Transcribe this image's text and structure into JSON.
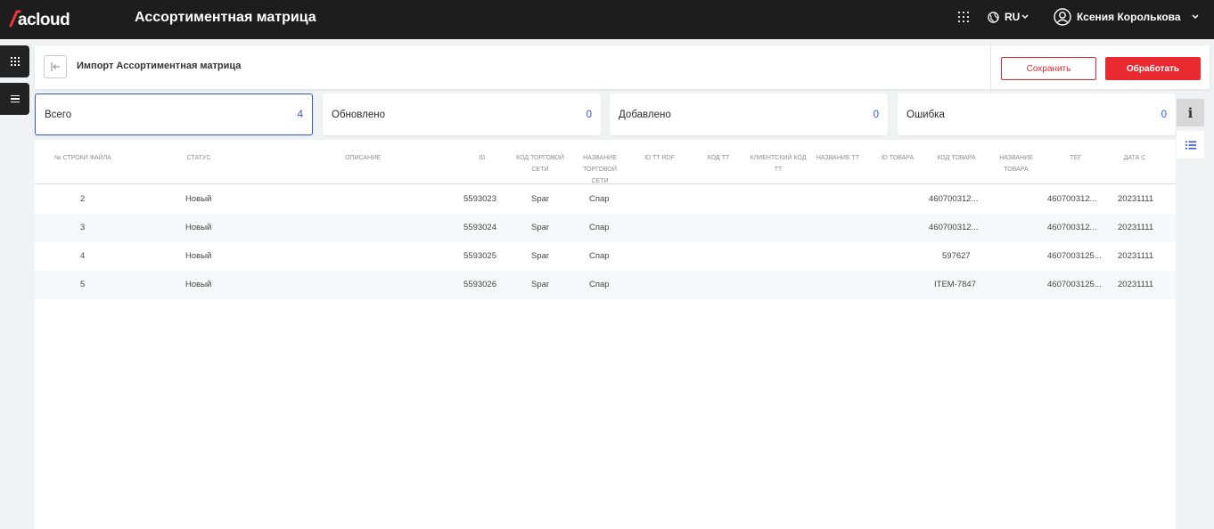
{
  "app": {
    "logo_text": "acloud",
    "title": "Ассортиментная матрица",
    "language": "RU",
    "user_name": "Ксения Королькова"
  },
  "header": {
    "title": "Импорт Ассортиментная матрица",
    "save_label": "Сохранить",
    "process_label": "Обработать"
  },
  "stats": [
    {
      "label": "Всего",
      "value": "4"
    },
    {
      "label": "Обновлено",
      "value": "0"
    },
    {
      "label": "Добавлено",
      "value": "0"
    },
    {
      "label": "Ошибка",
      "value": "0"
    }
  ],
  "table": {
    "columns": [
      "№ строки файла",
      "Статус",
      "Описание",
      "ID",
      "Код торговой сети",
      "Название торговой сети",
      "ID ТТ RDF",
      "Код ТТ",
      "Клиентский код ТТ",
      "Название ТТ",
      "ID товара",
      "Код товара",
      "Название товара",
      "Тег",
      "Дата с"
    ],
    "rows": [
      {
        "line": "2",
        "status": "Новый",
        "id": "5593023",
        "chain_code": "Spar",
        "chain_name": "Спар",
        "product_code": "460700312...",
        "tag": "460700312...",
        "date_from": "20231111"
      },
      {
        "line": "3",
        "status": "Новый",
        "id": "5593024",
        "chain_code": "Spar",
        "chain_name": "Спар",
        "product_code": "460700312...",
        "tag": "460700312...",
        "date_from": "20231111"
      },
      {
        "line": "4",
        "status": "Новый",
        "id": "5593025",
        "chain_code": "Spar",
        "chain_name": "Спар",
        "product_code": "597627",
        "tag": "4607003125...",
        "date_from": "20231111"
      },
      {
        "line": "5",
        "status": "Новый",
        "id": "5593026",
        "chain_code": "Spar",
        "chain_name": "Спар",
        "product_code": "ITEM-7847",
        "tag": "4607003125...",
        "date_from": "20231111"
      }
    ]
  },
  "icons": {
    "apps": "grid-icon",
    "language": "globe-icon",
    "user": "user-circle-icon",
    "back": "collapse-left-icon",
    "info": "info-icon",
    "list": "list-icon",
    "menu": "burger-icon"
  },
  "colors": {
    "accent_red": "#e8292f",
    "accent_blue": "#3a57c7",
    "topbar": "#1d1d1d"
  }
}
